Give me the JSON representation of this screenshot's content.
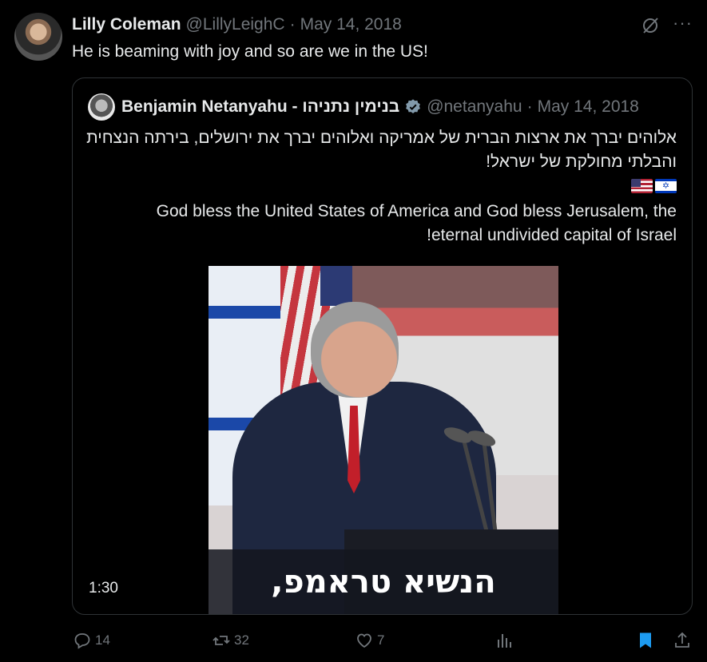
{
  "tweet": {
    "author_name": "Lilly Coleman",
    "author_handle": "@LillyLeighC",
    "separator": "·",
    "date": "May 14, 2018",
    "text": "He is beaming with joy and so are we in the US!",
    "more_icon": "···"
  },
  "quoted": {
    "author_name": "Benjamin Netanyahu - בנימין נתניהו",
    "author_handle": "@netanyahu",
    "separator": "·",
    "date": "May 14, 2018",
    "hebrew_text": "אלוהים יברך את ארצות הברית של אמריקה ואלוהים יברך את ירושלים, בירתה הנצחית והבלתי מחולקת של ישראל!",
    "flags": [
      "flag-us",
      "flag-il"
    ],
    "english_line_1": "God bless the United States of America and God bless Jerusalem, the",
    "english_line_2": "!eternal undivided capital of Israel",
    "video_caption": "הנשיא טראמפ,",
    "video_duration": "1:30"
  },
  "actions": {
    "replies": "14",
    "reposts": "32",
    "likes": "7"
  },
  "colors": {
    "background": "#000000",
    "text": "#e7e9ea",
    "muted": "#71767b",
    "border": "#2f3336",
    "bookmark_active": "#1d9bf0",
    "verified": "#829aab"
  }
}
